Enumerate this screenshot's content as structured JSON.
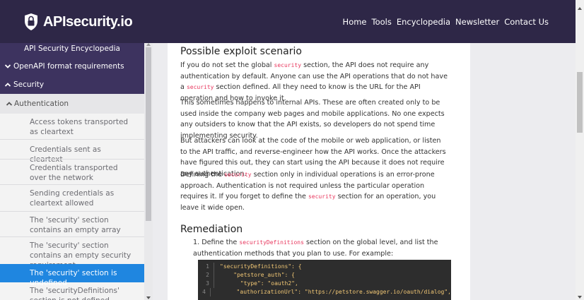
{
  "brand": {
    "name": "APIsecurity.io",
    "icon": "shield-lock-icon"
  },
  "nav": [
    "Home",
    "Tools",
    "Encyclopedia",
    "Newsletter",
    "Contact Us"
  ],
  "sidebar": {
    "top_item": "API Security Encyclopedia",
    "openapi": "OpenAPI format requirements",
    "security": "Security",
    "authentication": "Authentication",
    "items": [
      "Access tokens transported as cleartext",
      "Credentials sent as cleartext",
      "Credentials transported over the network",
      "Sending credentials as cleartext allowed",
      "The 'security' section contains an empty array",
      "The 'security' section contains an empty security requirement",
      "The 'security' section is undefined",
      "The 'securityDefinitions' section is not defined"
    ],
    "active_index": 6
  },
  "main": {
    "heading1": "Possible exploit scenario",
    "p1": [
      "If you do not set the global ",
      "security",
      " section, the API does not require any authentication by default. Anyone can use the API operations that do not have a ",
      "security",
      " section defined. All they need to know is the URL for the API operation and how to invoke it."
    ],
    "p2": "This sometimes happens to internal APIs. These are often created only to be used inside the company web pages and mobile applications. No one expects any outsiders to know that the API exists, so developers do not spend time implementing security.",
    "p3": "But  attackers can look at the code of the mobile or web application, or listen to the API traffic, and reverse-engineer how the API works. Once the attackers have figured this out, they can start using the API because it does not require any authentication.",
    "p4": [
      "Defining the ",
      "security",
      " section only in individual operations is an error-prone approach. Authentication is not required unless the particular operation requires it. If you forget to define the ",
      "security",
      " section for an operation, you leave it wide open."
    ],
    "heading2": "Remediation",
    "step1": [
      "1. Define the ",
      "securityDefinitions",
      " section on the global level, and list the authentication methods that you plan to use. For example:"
    ],
    "code": [
      {
        "n": "1",
        "text": "\"securityDefinitions\": {"
      },
      {
        "n": "2",
        "text": "    \"petstore_auth\": {"
      },
      {
        "n": "3",
        "text": "      \"type\": \"oauth2\","
      },
      {
        "n": "4",
        "text": "      \"authorizationUrl\": \"https://petstore.swagger.io/oauth/dialog\","
      }
    ]
  }
}
